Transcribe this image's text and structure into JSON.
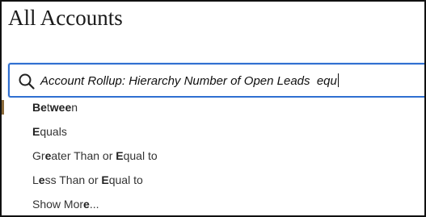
{
  "page": {
    "title": "All Accounts"
  },
  "search": {
    "value": "Account Rollup: Hierarchy Number of Open Leads  equ",
    "icon": "search-icon"
  },
  "dropdown": {
    "options": [
      {
        "label": "Between",
        "highlight": [
          "Be",
          "t",
          "wee",
          "n"
        ]
      },
      {
        "label": "Equals"
      },
      {
        "label": "Greater Than or Equal to"
      },
      {
        "label": "Less Than or Equal to"
      },
      {
        "label": "Show More..."
      }
    ]
  },
  "colors": {
    "focus_border": "#2f6fd1",
    "frame": "#111111"
  }
}
